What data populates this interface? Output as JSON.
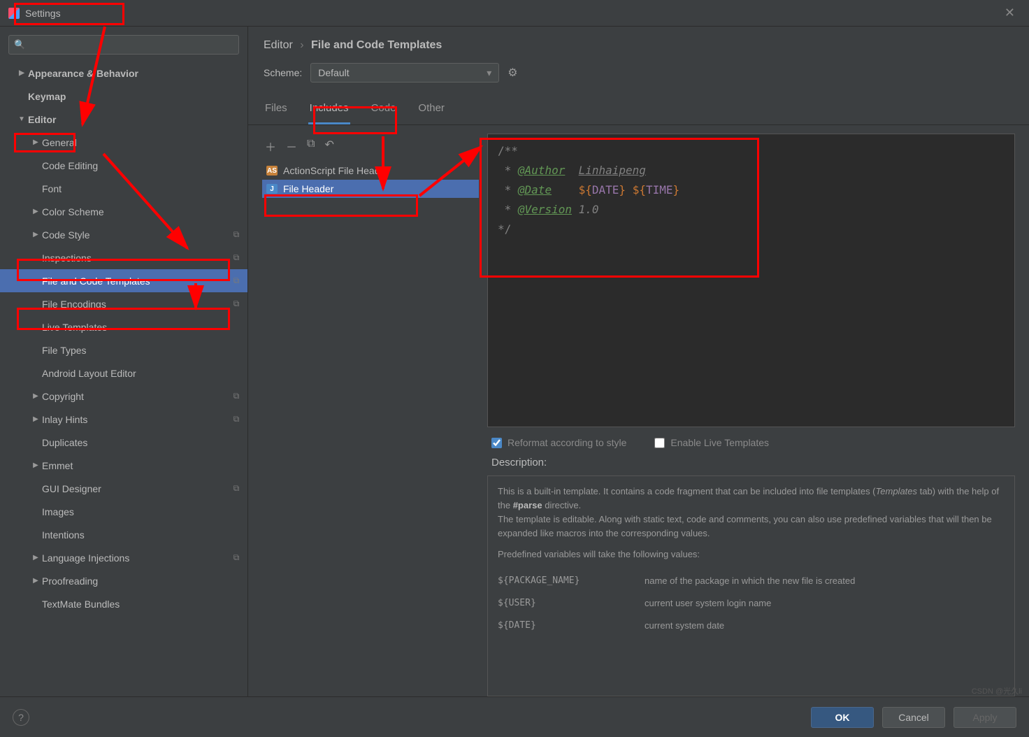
{
  "title": "Settings",
  "breadcrumb": {
    "item1": "Editor",
    "item2": "File and Code Templates"
  },
  "scheme": {
    "label": "Scheme:",
    "value": "Default"
  },
  "tabs": {
    "files": "Files",
    "includes": "Includes",
    "code": "Code",
    "other": "Other"
  },
  "sidebar": {
    "items": [
      {
        "label": "Appearance & Behavior",
        "arrow": "▶",
        "pad": 0,
        "bold": true
      },
      {
        "label": "Keymap",
        "arrow": "",
        "pad": 0,
        "bold": true
      },
      {
        "label": "Editor",
        "arrow": "▼",
        "pad": 0,
        "bold": true
      },
      {
        "label": "General",
        "arrow": "▶",
        "pad": 1
      },
      {
        "label": "Code Editing",
        "arrow": "",
        "pad": 1
      },
      {
        "label": "Font",
        "arrow": "",
        "pad": 1
      },
      {
        "label": "Color Scheme",
        "arrow": "▶",
        "pad": 1
      },
      {
        "label": "Code Style",
        "arrow": "▶",
        "pad": 1,
        "badge": true
      },
      {
        "label": "Inspections",
        "arrow": "",
        "pad": 1,
        "badge": true
      },
      {
        "label": "File and Code Templates",
        "arrow": "",
        "pad": 1,
        "badge": true,
        "selected": true
      },
      {
        "label": "File Encodings",
        "arrow": "",
        "pad": 1,
        "badge": true
      },
      {
        "label": "Live Templates",
        "arrow": "",
        "pad": 1
      },
      {
        "label": "File Types",
        "arrow": "",
        "pad": 1
      },
      {
        "label": "Android Layout Editor",
        "arrow": "",
        "pad": 1
      },
      {
        "label": "Copyright",
        "arrow": "▶",
        "pad": 1,
        "badge": true
      },
      {
        "label": "Inlay Hints",
        "arrow": "▶",
        "pad": 1,
        "badge": true
      },
      {
        "label": "Duplicates",
        "arrow": "",
        "pad": 1
      },
      {
        "label": "Emmet",
        "arrow": "▶",
        "pad": 1
      },
      {
        "label": "GUI Designer",
        "arrow": "",
        "pad": 1,
        "badge": true
      },
      {
        "label": "Images",
        "arrow": "",
        "pad": 1
      },
      {
        "label": "Intentions",
        "arrow": "",
        "pad": 1
      },
      {
        "label": "Language Injections",
        "arrow": "▶",
        "pad": 1,
        "badge": true
      },
      {
        "label": "Proofreading",
        "arrow": "▶",
        "pad": 1
      },
      {
        "label": "TextMate Bundles",
        "arrow": "",
        "pad": 1
      }
    ]
  },
  "templates": {
    "items": [
      {
        "icon": "AS",
        "iconClass": "as",
        "label": "ActionScript File Header"
      },
      {
        "icon": "J",
        "iconClass": "j",
        "label": "File Header",
        "selected": true
      }
    ]
  },
  "editor_code": {
    "line1": "/**",
    "l2_tag": "@Author",
    "l2_name": "Linhaipeng",
    "l3_tag": "@Date",
    "l3_d1": "DATE",
    "l3_d2": "TIME",
    "l4_tag": "@Version",
    "l4_val": "1.0",
    "line5": "*/"
  },
  "options": {
    "reformat": "Reformat according to style",
    "live": "Enable Live Templates"
  },
  "description": {
    "label": "Description:",
    "text1a": "This is a built-in template. It contains a code fragment that can be included into file templates (",
    "text1em": "Templates",
    "text1b": " tab) with the help of the ",
    "text1bold": "#parse",
    "text1c": " directive.",
    "text2": "The template is editable. Along with static text, code and comments, you can also use predefined variables that will then be expanded like macros into the corresponding values.",
    "text3": "Predefined variables will take the following values:",
    "vars": [
      {
        "key": "${PACKAGE_NAME}",
        "val": "name of the package in which the new file is created"
      },
      {
        "key": "${USER}",
        "val": "current user system login name"
      },
      {
        "key": "${DATE}",
        "val": "current system date"
      }
    ]
  },
  "footer": {
    "ok": "OK",
    "cancel": "Cancel",
    "apply": "Apply"
  },
  "watermark": "CSDN @光久li"
}
